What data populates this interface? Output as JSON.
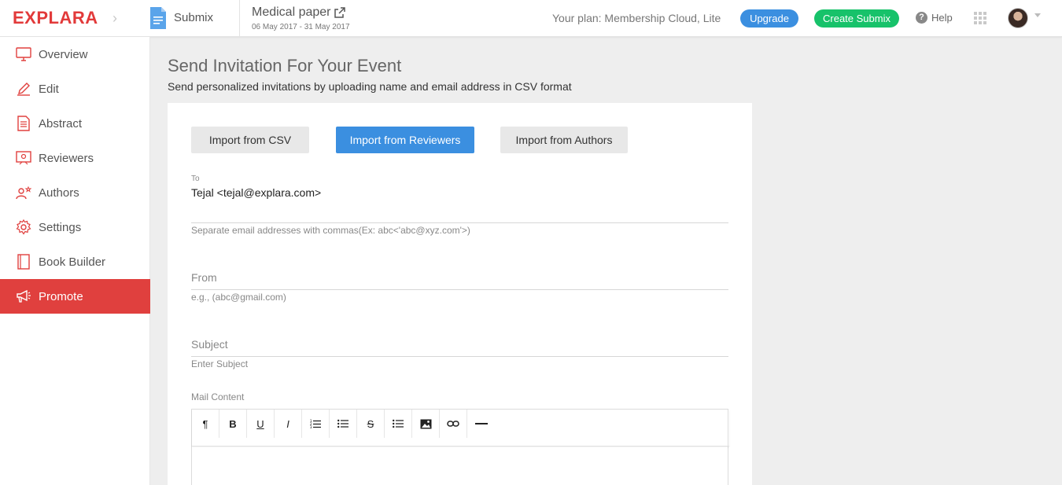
{
  "header": {
    "logo": "EXPLARA",
    "product": "Submix",
    "event_title": "Medical paper",
    "event_dates": "06 May 2017 - 31 May 2017",
    "plan_text": "Your plan: Membership Cloud, Lite",
    "upgrade_label": "Upgrade",
    "create_label": "Create Submix",
    "help_label": "Help"
  },
  "sidebar": {
    "items": [
      {
        "label": "Overview",
        "icon": "monitor-icon"
      },
      {
        "label": "Edit",
        "icon": "pencil-icon"
      },
      {
        "label": "Abstract",
        "icon": "document-icon"
      },
      {
        "label": "Reviewers",
        "icon": "reviewers-icon"
      },
      {
        "label": "Authors",
        "icon": "authors-icon"
      },
      {
        "label": "Settings",
        "icon": "gear-icon"
      },
      {
        "label": "Book Builder",
        "icon": "book-icon"
      },
      {
        "label": "Promote",
        "icon": "megaphone-icon",
        "active": true
      }
    ]
  },
  "main": {
    "title": "Send Invitation For Your Event",
    "subtitle": "Send personalized invitations by uploading name and email address in CSV format",
    "tabs": {
      "csv": "Import from CSV",
      "reviewers": "Import from Reviewers",
      "authors": "Import from Authors"
    },
    "to_label": "To",
    "to_value": "Tejal <tejal@explara.com>",
    "to_hint": "Separate email addresses with commas(Ex: abc<'abc@xyz.com'>)",
    "from_placeholder": "From",
    "from_hint": "e.g., (abc@gmail.com)",
    "subject_placeholder": "Subject",
    "subject_hint": "Enter Subject",
    "mail_content_label": "Mail Content"
  },
  "colors": {
    "brand_red": "#e23a3a",
    "active_nav": "#e0403e",
    "primary_blue": "#3b8fe0",
    "create_green": "#17c26a"
  }
}
